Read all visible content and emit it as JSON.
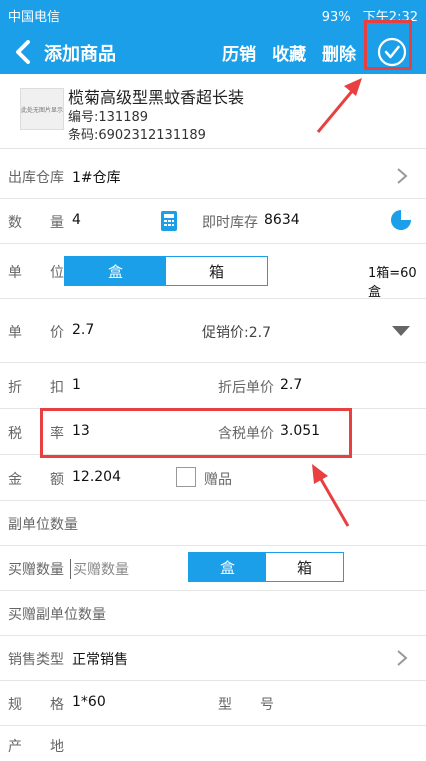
{
  "status_bar": {
    "carrier": "中国电信",
    "battery": "93%",
    "time": "下午2:32"
  },
  "app_bar": {
    "title": "添加商品",
    "history_label": "历销",
    "favorite_label": "收藏",
    "delete_label": "删除"
  },
  "product": {
    "name": "榄菊高级型黑蚊香超长装",
    "code": "编号:131189",
    "barcode": "条码:6902312131189",
    "thumb_text": "此处无图片显示"
  },
  "form": {
    "warehouse": {
      "label": "出库仓库",
      "value": "1#仓库"
    },
    "quantity": {
      "label_a": "数",
      "label_b": "量",
      "value": "4",
      "stock_label": "即时库存",
      "stock_value": "8634"
    },
    "unit": {
      "label_a": "单",
      "label_b": "位",
      "option1": "盒",
      "option2": "箱",
      "conversion": "1箱=60盒"
    },
    "price": {
      "label_a": "单",
      "label_b": "价",
      "value": "2.7",
      "promo": "促销价:2.7"
    },
    "discount": {
      "label_a": "折",
      "label_b": "扣",
      "value": "1",
      "after_label": "折后单价",
      "after_value": "2.7"
    },
    "tax": {
      "label_a": "税",
      "label_b": "率",
      "value": "13",
      "taxed_label": "含税单价",
      "taxed_value": "3.051"
    },
    "amount": {
      "label_a": "金",
      "label_b": "额",
      "value": "12.204",
      "gift_label": "赠品"
    },
    "sub_unit_qty": {
      "label": "副单位数量"
    },
    "gift_qty": {
      "label": "买赠数量",
      "placeholder": "买赠数量",
      "option1": "盒",
      "option2": "箱"
    },
    "gift_sub_qty": {
      "label": "买赠副单位数量"
    },
    "sale_type": {
      "label": "销售类型",
      "value": "正常销售"
    },
    "spec": {
      "label_a": "规",
      "label_b": "格",
      "value": "1*60",
      "model_a": "型",
      "model_b": "号"
    },
    "origin": {
      "label_a": "产",
      "label_b": "地"
    }
  }
}
